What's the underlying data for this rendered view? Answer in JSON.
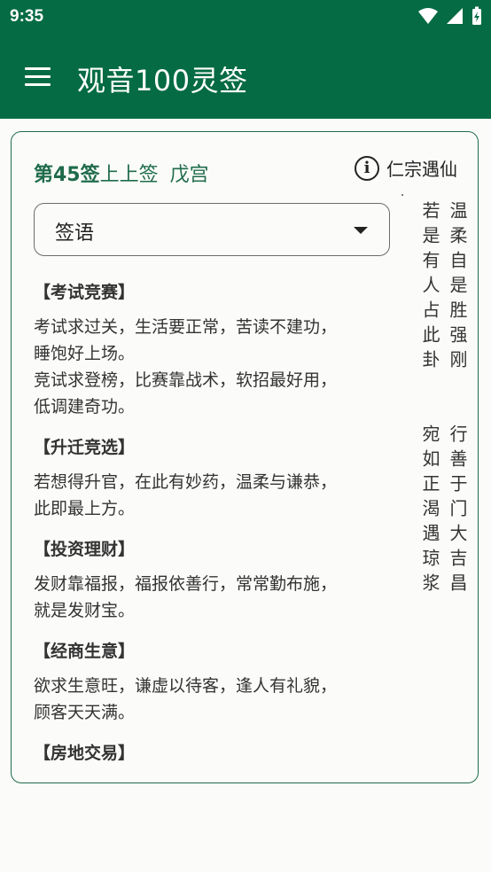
{
  "status_bar": {
    "time": "9:35"
  },
  "app_bar": {
    "title": "观音100灵签"
  },
  "card": {
    "number": "第45签",
    "rank": "上上签",
    "palace": "戊宫",
    "story_label": "仁宗遇仙",
    "select": {
      "value": "签语"
    },
    "poem_columns": [
      "温柔自是胜强刚",
      "若是有人占此卦",
      "",
      "行善于门大吉昌",
      "宛如正渴遇琼浆"
    ],
    "sections": [
      {
        "title": "【考试竞赛】",
        "lines": [
          "考试求过关，生活要正常，苦读不建功，",
          "睡饱好上场。",
          "竞试求登榜，比赛靠战术，软招最好用，",
          "低调建奇功。"
        ]
      },
      {
        "title": "【升迁竞选】",
        "lines": [
          "若想得升官，在此有妙药，温柔与谦恭，",
          "此即最上方。"
        ]
      },
      {
        "title": "【投资理财】",
        "lines": [
          "发财靠福报，福报依善行，常常勤布施，",
          "就是发财宝。"
        ]
      },
      {
        "title": "【经商生意】",
        "lines": [
          "欲求生意旺，谦虚以待客，逢人有礼貌，",
          "顾客天天满。"
        ]
      },
      {
        "title": "【房地交易】",
        "lines": []
      }
    ]
  }
}
